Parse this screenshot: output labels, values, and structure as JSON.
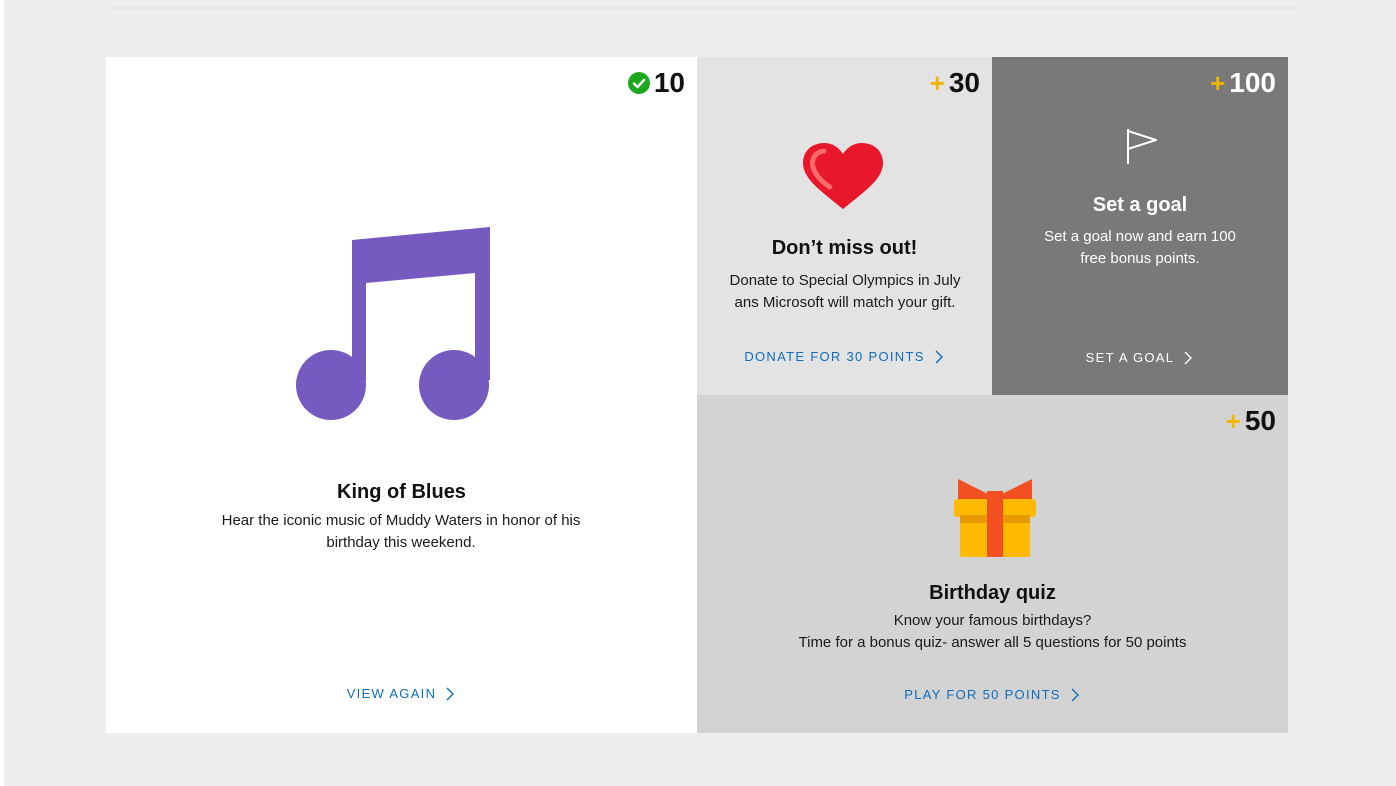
{
  "cards": {
    "blues": {
      "points": "10",
      "title": "King of Blues",
      "desc": "Hear the iconic music of Muddy Waters in honor of his birthday this weekend.",
      "cta": "VIEW AGAIN",
      "icon": "music-note-icon",
      "status": "completed"
    },
    "donate": {
      "plus": "+",
      "points": "30",
      "title": "Don’t miss out!",
      "desc": "Donate to Special Olympics in July ans Microsoft will match your gift.",
      "cta": "DONATE FOR 30 POINTS",
      "icon": "heart-icon"
    },
    "goal": {
      "plus": "+",
      "points": "100",
      "title": "Set a goal",
      "desc": "Set a goal now and earn 100 free bonus points.",
      "cta": "SET A GOAL",
      "icon": "flag-icon"
    },
    "quiz": {
      "plus": "+",
      "points": "50",
      "title": "Birthday quiz",
      "desc_line1": "Know your famous birthdays?",
      "desc_line2": "Time for a bonus quiz- answer all 5 questions for 50 points",
      "cta": "PLAY FOR 50 POINTS",
      "icon": "gift-icon"
    }
  },
  "colors": {
    "accent_link": "#0f6cbd",
    "plus_gold": "#f2b600",
    "check_green": "#1ea81e",
    "music_purple": "#755bc0",
    "heart_red": "#e8172b"
  }
}
